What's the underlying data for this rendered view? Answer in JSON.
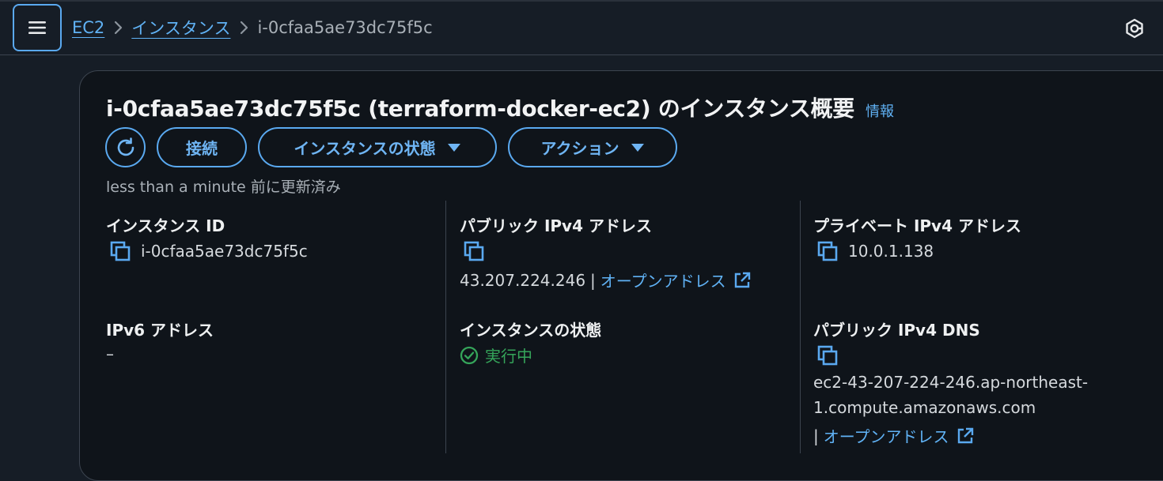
{
  "header": {
    "menu_icon": "hamburger-icon",
    "breadcrumbs": [
      {
        "label": "EC2",
        "link": true
      },
      {
        "label": "インスタンス",
        "link": true
      },
      {
        "label": "i-0cfaa5ae73dc75f5c",
        "link": false
      }
    ],
    "help_icon": "notifications-icon"
  },
  "summary": {
    "title": "i-0cfaa5ae73dc75f5c (terraform-docker-ec2) のインスタンス概要",
    "info_link": "情報",
    "buttons": {
      "refresh_icon": "refresh-icon",
      "connect": "接続",
      "instance_state": "インスタンスの状態",
      "actions": "アクション"
    },
    "last_updated": "less than a minute 前に更新済み"
  },
  "fields": {
    "instance_id": {
      "label": "インスタンス ID",
      "value": "i-0cfaa5ae73dc75f5c"
    },
    "public_ipv4": {
      "label": "パブリック IPv4 アドレス",
      "value": "43.207.224.246",
      "separator": "|",
      "link": "オープンアドレス"
    },
    "private_ipv4": {
      "label": "プライベート IPv4 アドレス",
      "value": "10.0.1.138"
    },
    "ipv6": {
      "label": "IPv6 アドレス",
      "value": "–"
    },
    "instance_state": {
      "label": "インスタンスの状態",
      "value": "実行中"
    },
    "public_dns": {
      "label": "パブリック IPv4 DNS",
      "value_line1": "ec2-43-207-224-246.ap-northeast-",
      "value_line2": "1.compute.amazonaws.com",
      "separator": "|",
      "link": "オープンアドレス"
    }
  },
  "colors": {
    "background": "#161d26",
    "panel": "#0f141a",
    "accent": "#5aa9f0",
    "link": "#60b2f5",
    "success": "#35a55a",
    "border": "#3c444f"
  }
}
